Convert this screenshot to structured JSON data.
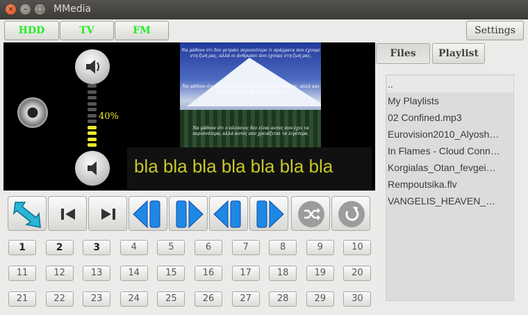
{
  "window": {
    "title": "MMedia",
    "close_glyph": "×",
    "min_glyph": "–",
    "max_glyph": "□"
  },
  "toolbar": {
    "hdd": "HDD",
    "tv": "TV",
    "fm": "FM",
    "settings": "Settings"
  },
  "colors": {
    "tab_text_green": "#22ee22",
    "ticker_text": "#c9c82a",
    "volume_yellow": "#e9e82b",
    "control_blue": "#1e88e5",
    "control_teal": "#29b6d6"
  },
  "video": {
    "caption_top": "Να μάθουν ότι δεν μετράει περισσότερο τι πράγματα που έχουμε στη ζωή μας, αλλά οι άνθρωποι που έχουμε στη ζωή μας.",
    "caption_mid": "Να μάθουν ότι δεν ακρεί να συγχωρούμε τους άλλους, αλλά και να συγχωρούμε μας τους άλλους.",
    "caption_bot": "Να μάθουν ότι ο πλούσιος δεν είναι αυτός που έχει τα περισσότερα, αλλά αυτός που χρειάζεται τα λιγότερα.",
    "ticker": "bla bla bla bla bla bla bla"
  },
  "volume": {
    "percent_label": "40%",
    "level": 0.4,
    "up_icon": "speaker-up-icon",
    "down_icon": "speaker-down-icon"
  },
  "controls": [
    {
      "name": "open-button",
      "icon": "arrow-icon"
    },
    {
      "name": "prev-track-button",
      "icon": "skip-back-icon"
    },
    {
      "name": "next-track-button",
      "icon": "skip-forward-icon"
    },
    {
      "name": "rewind-button",
      "icon": "rewind-icon"
    },
    {
      "name": "fast-forward-button",
      "icon": "fast-forward-icon"
    },
    {
      "name": "step-back-button",
      "icon": "step-back-icon"
    },
    {
      "name": "step-forward-button",
      "icon": "step-forward-icon"
    },
    {
      "name": "shuffle-button",
      "icon": "shuffle-icon"
    },
    {
      "name": "repeat-button",
      "icon": "repeat-icon"
    }
  ],
  "channels": [
    "1",
    "2",
    "3",
    "4",
    "5",
    "6",
    "7",
    "8",
    "9",
    "10",
    "11",
    "12",
    "13",
    "14",
    "15",
    "16",
    "17",
    "18",
    "19",
    "20",
    "21",
    "22",
    "23",
    "24",
    "25",
    "26",
    "27",
    "28",
    "29",
    "30"
  ],
  "tabs": {
    "files": "Files",
    "playlist": "Playlist"
  },
  "files": [
    "..",
    "My Playlists",
    "02 Confined.mp3",
    "Eurovision2010_Alyosh…",
    "In Flames - Cloud Conn…",
    "Korgialas_Otan_fevgei…",
    "Rempoutsika.flv",
    "VANGELIS_HEAVEN_…"
  ]
}
